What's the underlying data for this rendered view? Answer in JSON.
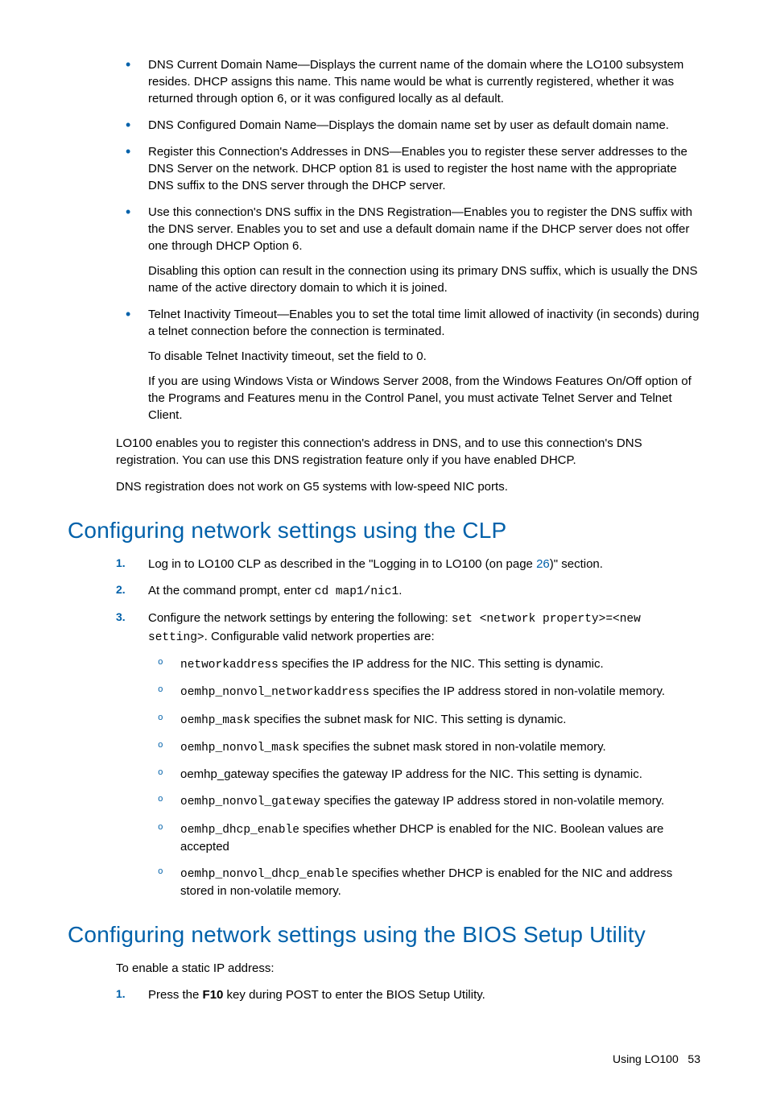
{
  "bullets": [
    {
      "text": "DNS Current Domain Name—Displays the current name of the domain where the LO100 subsystem resides. DHCP assigns this name. This name would be what is currently registered, whether it was returned through option 6, or it was configured locally as al default."
    },
    {
      "text": "DNS Configured Domain Name—Displays the domain name set by user as default domain name."
    },
    {
      "text": "Register this Connection's Addresses in DNS—Enables you to register these server addresses to the DNS Server on the network. DHCP option 81 is used to register the host name with the appropriate DNS suffix to the DNS server through the DHCP server."
    },
    {
      "text": "Use this connection's DNS suffix in the DNS Registration—Enables you to register the DNS suffix with the DNS server. Enables you to set and use a default domain name if the DHCP server does not offer one through DHCP Option 6.",
      "extra": [
        "Disabling this option can result in the connection using its primary DNS suffix, which is usually the DNS name of the active directory domain to which it is joined."
      ]
    },
    {
      "text": "Telnet Inactivity Timeout—Enables you to set the total time limit allowed of inactivity (in seconds) during a telnet connection before the connection is terminated.",
      "extra": [
        "To disable Telnet Inactivity timeout, set the field to 0.",
        "If you are using Windows Vista or Windows Server 2008, from the Windows Features On/Off option of the Programs and Features menu in the Control Panel, you must activate Telnet Server and Telnet Client."
      ]
    }
  ],
  "after_bullets": [
    "LO100 enables you to register this connection's address in DNS, and to use this connection's DNS registration. You can use this DNS registration feature only if you have enabled DHCP.",
    "DNS registration does not work on G5 systems with low-speed NIC ports."
  ],
  "heading_clp": "Configuring network settings using the CLP",
  "clp_steps": {
    "s1_a": "Log in to LO100 CLP as described in the \"Logging in to LO100 (on page ",
    "s1_link": "26",
    "s1_b": ")\" section.",
    "s2_a": "At the command prompt, enter ",
    "s2_code": "cd map1/nic1",
    "s2_b": ".",
    "s3_a": "Configure the network settings by entering the following: ",
    "s3_code1": "set <network property>=<new setting>",
    "s3_b": ". Configurable valid network properties are:"
  },
  "clp_sub": [
    {
      "code": "networkaddress",
      "rest": " specifies the IP address for the NIC. This setting is dynamic."
    },
    {
      "code": "oemhp_nonvol_networkaddress",
      "rest": " specifies the IP address stored in non-volatile memory."
    },
    {
      "code": "oemhp_mask",
      "rest": " specifies the subnet mask for NIC. This setting is dynamic."
    },
    {
      "code": "oemhp_nonvol_mask",
      "rest": " specifies the subnet mask stored in non-volatile memory."
    },
    {
      "plain": "oemhp_gateway specifies the gateway IP address for the NIC. This setting is dynamic."
    },
    {
      "code": "oemhp_nonvol_gateway",
      "rest": " specifies the gateway IP address stored in non-volatile memory."
    },
    {
      "code": "oemhp_dhcp_enable",
      "rest": " specifies whether DHCP is enabled for the NIC. Boolean values are accepted"
    },
    {
      "code": "oemhp_nonvol_dhcp_enable",
      "rest": " specifies whether DHCP is enabled for the NIC and address stored in non-volatile memory."
    }
  ],
  "heading_bios": "Configuring network settings using the BIOS Setup Utility",
  "bios_intro": "To enable a static IP address:",
  "bios_step1_a": "Press the ",
  "bios_step1_key": "F10",
  "bios_step1_b": " key during POST to enter the BIOS Setup Utility.",
  "footer_label": "Using LO100",
  "footer_page": "53"
}
